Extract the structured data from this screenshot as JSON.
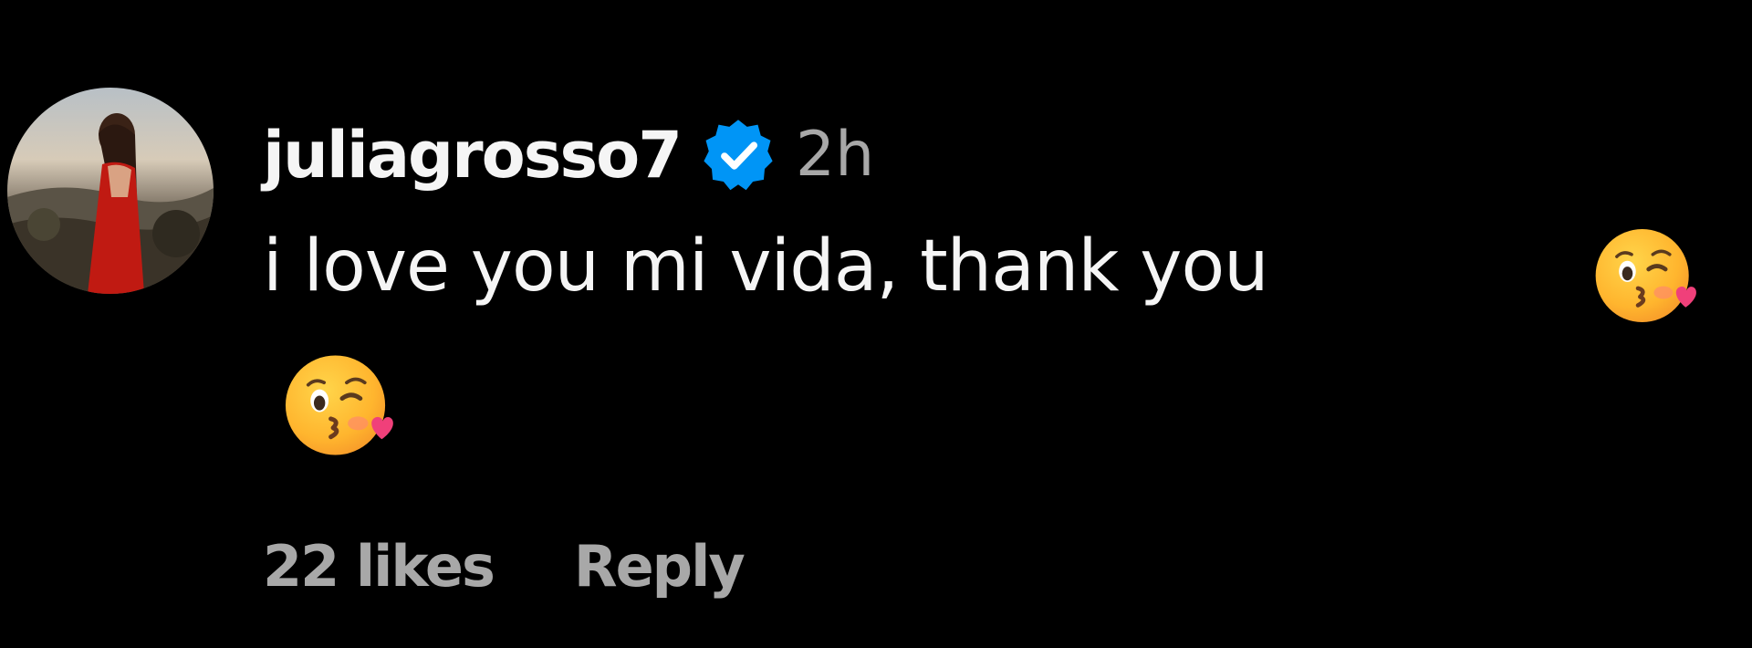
{
  "comment": {
    "username": "juliagrosso7",
    "verified_icon": "verified-badge-icon",
    "time": "2h",
    "text": "i love you mi vida, thank you",
    "emoji": "face-blowing-a-kiss",
    "likes": "22 likes",
    "reply_label": "Reply"
  },
  "colors": {
    "background": "#000000",
    "primary_text": "#f5f5f5",
    "secondary_text": "#a8a8a8",
    "verified_blue": "#0095f6"
  }
}
